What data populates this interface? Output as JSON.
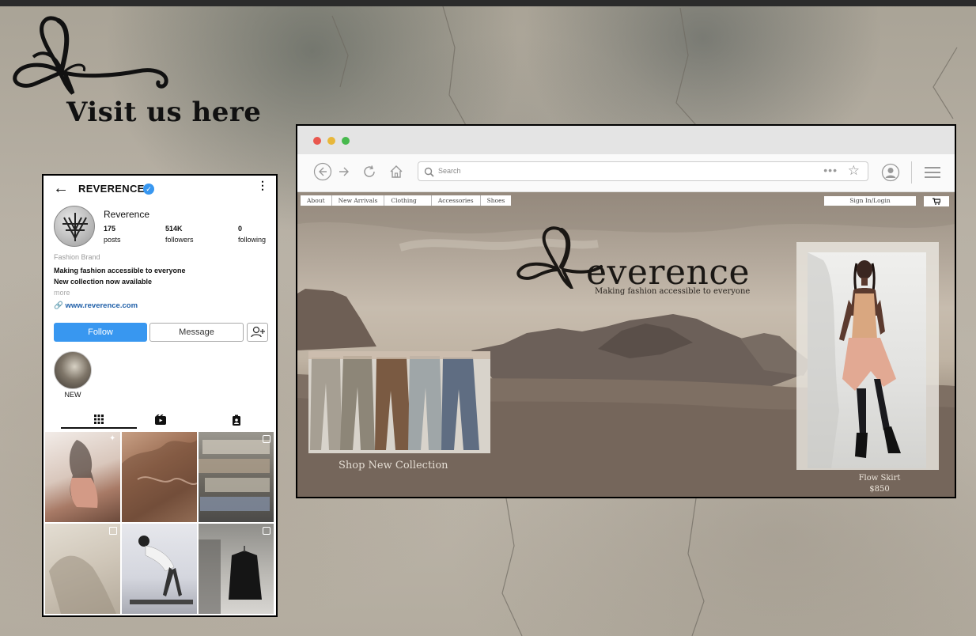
{
  "poster": {
    "visit_text": "Visit us here"
  },
  "instagram": {
    "handle": "REVERENCE",
    "display_name": "Reverence",
    "stats": [
      {
        "value": "175",
        "label": "posts"
      },
      {
        "value": "514K",
        "label": "followers"
      },
      {
        "value": "0",
        "label": "following"
      }
    ],
    "category": "Fashion Brand",
    "bio_line1": "Making fashion accessible to everyone",
    "bio_line2": "New collection now available",
    "more": "more",
    "link": "www.reverence.com",
    "follow_label": "Follow",
    "message_label": "Message",
    "highlight_label": "NEW",
    "tabs": [
      "grid-icon",
      "reels-icon",
      "tagged-icon"
    ],
    "accent_color": "#3897f0"
  },
  "browser": {
    "search_placeholder": "Search",
    "nav_icons": [
      "back-icon",
      "forward-icon",
      "reload-icon",
      "home-icon",
      "more-icon",
      "star-icon",
      "profile-icon",
      "menu-icon"
    ]
  },
  "site": {
    "nav": [
      "About",
      "New Arrivals",
      "Clothing",
      "Accessories",
      "Shoes"
    ],
    "signin_label": "Sign In/Login",
    "brand_word": "everence",
    "tagline": "Making fashion accessible to everyone",
    "shop_label": "Shop New Collection",
    "product_name": "Flow Skirt",
    "product_price": "$850"
  }
}
